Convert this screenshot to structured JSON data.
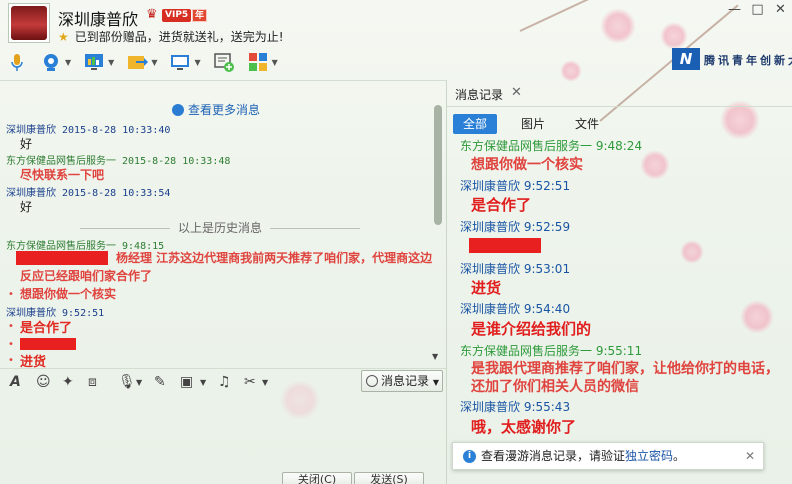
{
  "header": {
    "contact_name": "深圳康普欣",
    "vip_badge": "VIP5",
    "vip_year": "年",
    "signature": "已到部份赠品，进货就送礼，送完为止!"
  },
  "window_controls": {
    "minimize": "—",
    "maximize": "□",
    "close": "✕"
  },
  "toolbar": {
    "items": [
      "microphone-icon",
      "video-icon",
      "screen-share-icon",
      "file-transfer-icon",
      "remote-desktop-icon",
      "new-session-icon",
      "apps-icon"
    ]
  },
  "brand": {
    "logo": "N",
    "text": "腾讯青年创新大"
  },
  "chat": {
    "more_messages": "查看更多消息",
    "divider": "以上是历史消息",
    "messages": [
      {
        "head": "深圳康普欣  2015-8-28 10:33:40",
        "body": "好"
      },
      {
        "head": "东方保健品网售后服务一  2015-8-28 10:33:48",
        "body": "尽快联系一下吧"
      },
      {
        "head": "深圳康普欣  2015-8-28 10:33:54",
        "body": "好"
      },
      {
        "head": "东方保健品网售后服务一   9:48:15",
        "body": "杨经理  江苏这边代理商我前两天推荐了咱们家，代理商这边反应已经跟咱们家合作了"
      },
      {
        "body": "想跟你做一个核实"
      },
      {
        "head": "深圳康普欣   9:52:51",
        "body": "是合作了"
      },
      {
        "body": "进货"
      }
    ]
  },
  "input_tools": {
    "history_button": "消息记录"
  },
  "footer": {
    "close": "关闭(C)",
    "send": "发送(S)"
  },
  "history": {
    "tab_label": "消息记录",
    "filters": [
      "全部",
      "图片",
      "文件"
    ],
    "entries": [
      {
        "head": "东方保健品网售后服务一  9:48:24",
        "body": "想跟你做一个核实"
      },
      {
        "head": "深圳康普欣  9:52:51",
        "body": "是合作了"
      },
      {
        "head": "深圳康普欣  9:52:59",
        "body": ""
      },
      {
        "head": "深圳康普欣  9:53:01",
        "body": "进货"
      },
      {
        "head": "深圳康普欣  9:54:40",
        "body": "是谁介绍给我们的"
      },
      {
        "head": "东方保健品网售后服务一  9:55:11",
        "body": "是我跟代理商推荐了咱们家，让他给你打的电话，还加了你们相关人员的微信"
      },
      {
        "head": "深圳康普欣  9:55:43",
        "body": "哦，太感谢你了"
      }
    ],
    "notice_prefix": "查看漫游消息记录，请验证",
    "notice_link": "独立密码",
    "notice_suffix": "。"
  }
}
